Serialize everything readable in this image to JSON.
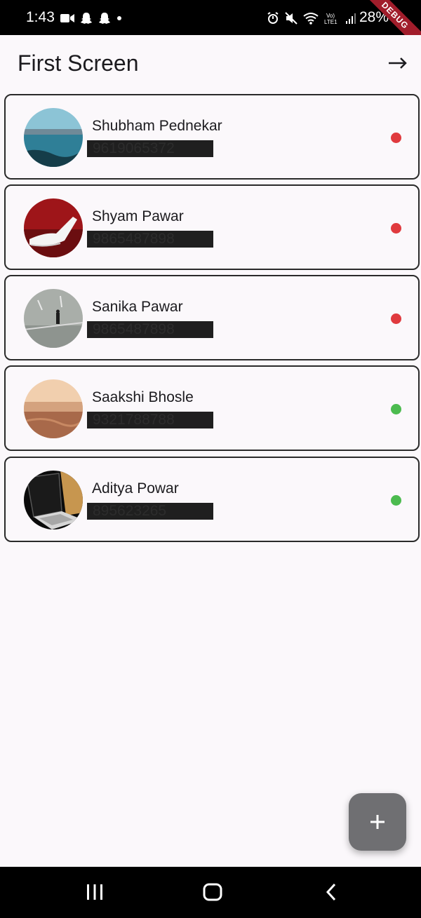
{
  "status_bar": {
    "time": "1:43",
    "battery": "28%",
    "left_icons": [
      "video-camera-icon",
      "snapchat-icon",
      "snapchat-icon",
      "dot-icon"
    ],
    "right_icons": [
      "alarm-icon",
      "mute-icon",
      "wifi-icon",
      "volte-icon",
      "signal-icon"
    ],
    "debug_label": "DEBUG"
  },
  "app_bar": {
    "title": "First Screen",
    "action_icon": "arrow-right-icon"
  },
  "contacts": [
    {
      "name": "Shubham Pednekar",
      "phone": "9619065372",
      "status_color": "#e03a3e"
    },
    {
      "name": "Shyam Pawar",
      "phone": "9865487898",
      "status_color": "#e03a3e"
    },
    {
      "name": "Sanika Pawar",
      "phone": "9865487898",
      "status_color": "#e03a3e"
    },
    {
      "name": "Saakshi Bhosle",
      "phone": "9321788788",
      "status_color": "#4cbb4f"
    },
    {
      "name": "Aditya Powar",
      "phone": "895623265",
      "status_color": "#4cbb4f"
    }
  ],
  "fab": {
    "icon": "plus-icon"
  },
  "nav_bar": {
    "icons": [
      "recents-icon",
      "home-icon",
      "back-icon"
    ]
  },
  "colors": {
    "background": "#fbf8fb",
    "card_border": "#2a2a2a",
    "fab": "#6f6f72",
    "status_red": "#e03a3e",
    "status_green": "#4cbb4f"
  }
}
